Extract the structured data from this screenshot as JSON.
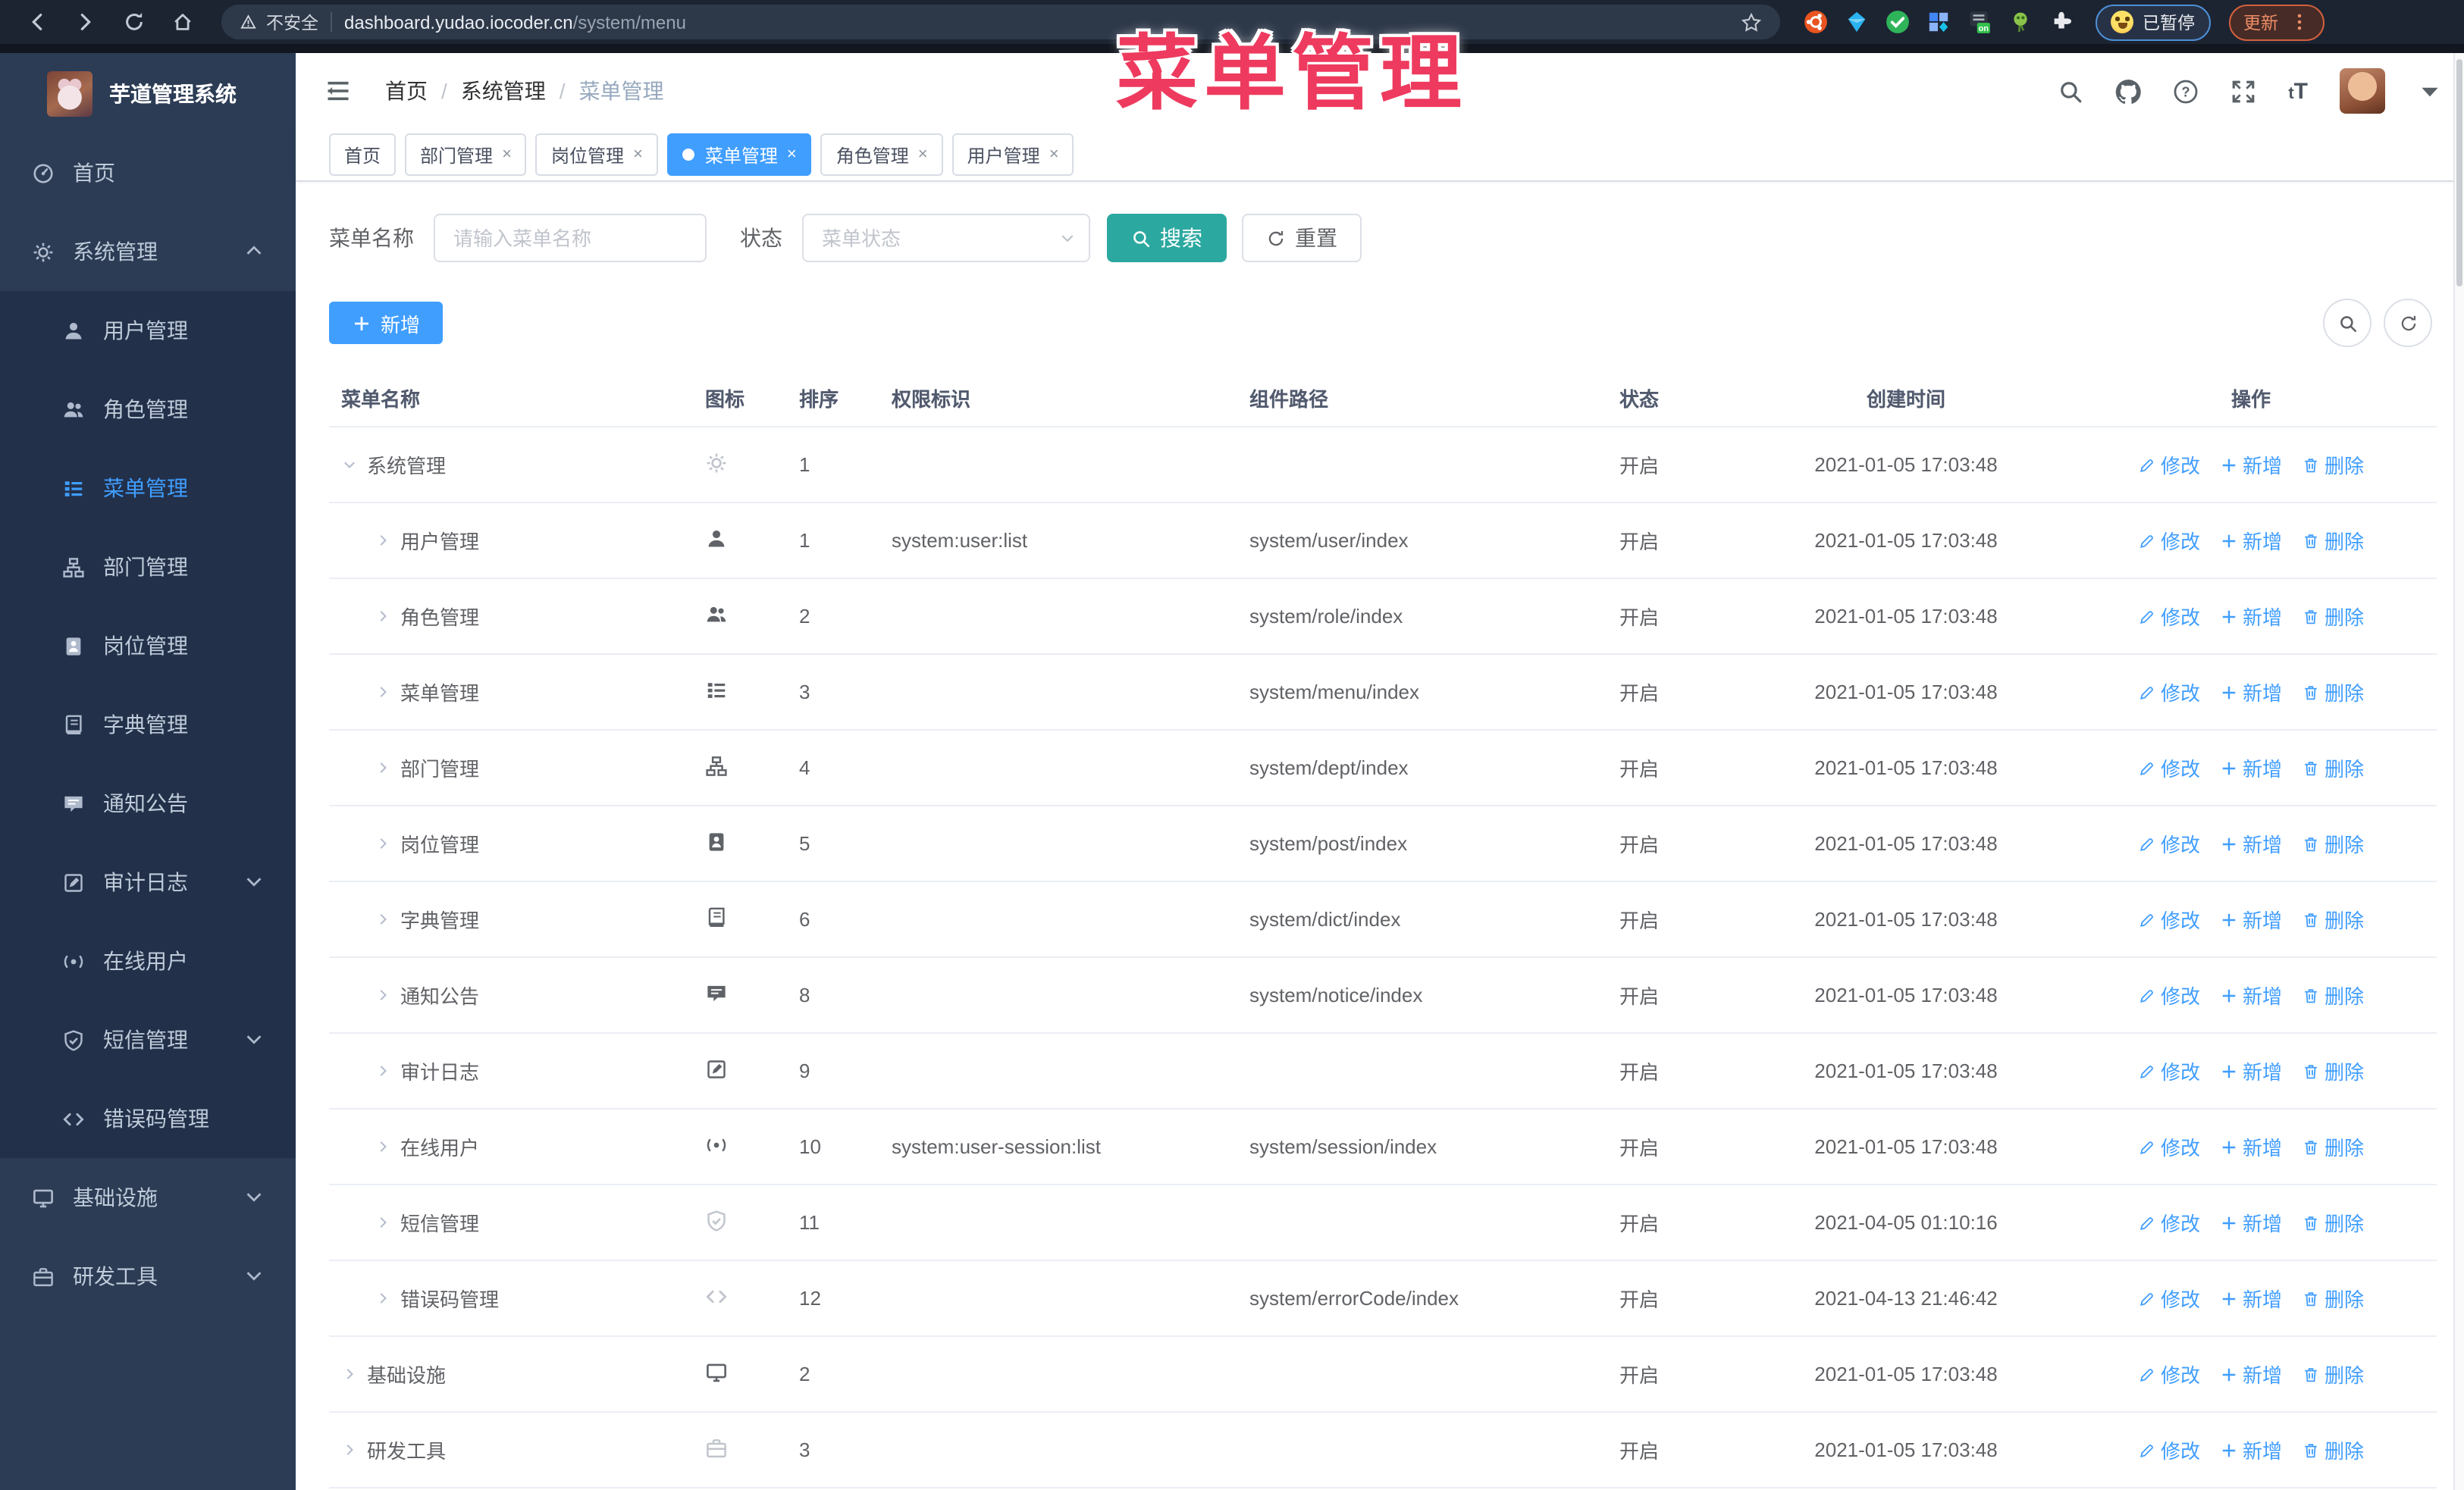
{
  "browser": {
    "security_label": "不安全",
    "url_domain": "dashboard.yudao.iocoder.cn",
    "url_path": "/system/menu",
    "extension_badge": "on",
    "profile_chip_label": "已暂停",
    "update_button_label": "更新"
  },
  "overlay": {
    "title": "菜单管理",
    "color": "#ee3a5e"
  },
  "sidebar": {
    "app_title": "芋道管理系统",
    "items": [
      {
        "label": "首页",
        "icon": "dashboard-icon"
      },
      {
        "label": "系统管理",
        "icon": "gear-icon",
        "arrow": "up",
        "children": [
          {
            "label": "用户管理",
            "icon": "user-icon"
          },
          {
            "label": "角色管理",
            "icon": "users-icon"
          },
          {
            "label": "菜单管理",
            "icon": "menu-icon",
            "active": true
          },
          {
            "label": "部门管理",
            "icon": "dept-icon"
          },
          {
            "label": "岗位管理",
            "icon": "post-icon"
          },
          {
            "label": "字典管理",
            "icon": "dict-icon"
          },
          {
            "label": "通知公告",
            "icon": "notice-icon"
          },
          {
            "label": "审计日志",
            "icon": "log-icon",
            "arrow": "down"
          },
          {
            "label": "在线用户",
            "icon": "online-icon"
          },
          {
            "label": "短信管理",
            "icon": "sms-icon",
            "arrow": "down"
          },
          {
            "label": "错误码管理",
            "icon": "code-icon"
          }
        ]
      },
      {
        "label": "基础设施",
        "icon": "infra-icon",
        "arrow": "down"
      },
      {
        "label": "研发工具",
        "icon": "tool-icon",
        "arrow": "down"
      }
    ]
  },
  "header": {
    "breadcrumb": [
      "首页",
      "系统管理",
      "菜单管理"
    ],
    "right_icons": [
      "search-icon",
      "github-icon",
      "question-icon",
      "fullscreen-icon",
      "font-size-icon",
      "avatar",
      "caret-down-icon"
    ]
  },
  "tabs": [
    {
      "label": "首页",
      "closable": false,
      "active": false
    },
    {
      "label": "部门管理",
      "closable": true,
      "active": false
    },
    {
      "label": "岗位管理",
      "closable": true,
      "active": false
    },
    {
      "label": "菜单管理",
      "closable": true,
      "active": true
    },
    {
      "label": "角色管理",
      "closable": true,
      "active": false
    },
    {
      "label": "用户管理",
      "closable": true,
      "active": false
    }
  ],
  "filters": {
    "name_label": "菜单名称",
    "name_placeholder": "请输入菜单名称",
    "status_label": "状态",
    "status_placeholder": "菜单状态",
    "search_label": "搜索",
    "reset_label": "重置"
  },
  "toolbar": {
    "add_label": "新增"
  },
  "table": {
    "columns": [
      "菜单名称",
      "图标",
      "排序",
      "权限标识",
      "组件路径",
      "状态",
      "创建时间",
      "操作"
    ],
    "actions": [
      {
        "label": "修改",
        "icon": "edit-icon"
      },
      {
        "label": "新增",
        "icon": "plus-icon"
      },
      {
        "label": "删除",
        "icon": "trash-icon"
      }
    ],
    "rows": [
      {
        "level": 0,
        "expanded": true,
        "name": "系统管理",
        "icon": "gear-icon",
        "muted": true,
        "sort": "1",
        "perm": "",
        "path": "",
        "status": "开启",
        "time": "2021-01-05 17:03:48"
      },
      {
        "level": 1,
        "expanded": false,
        "name": "用户管理",
        "icon": "user-icon",
        "muted": false,
        "sort": "1",
        "perm": "system:user:list",
        "path": "system/user/index",
        "status": "开启",
        "time": "2021-01-05 17:03:48"
      },
      {
        "level": 1,
        "expanded": false,
        "name": "角色管理",
        "icon": "users-icon",
        "muted": false,
        "sort": "2",
        "perm": "",
        "path": "system/role/index",
        "status": "开启",
        "time": "2021-01-05 17:03:48"
      },
      {
        "level": 1,
        "expanded": false,
        "name": "菜单管理",
        "icon": "menu-icon",
        "muted": false,
        "sort": "3",
        "perm": "",
        "path": "system/menu/index",
        "status": "开启",
        "time": "2021-01-05 17:03:48"
      },
      {
        "level": 1,
        "expanded": false,
        "name": "部门管理",
        "icon": "dept-icon",
        "muted": false,
        "sort": "4",
        "perm": "",
        "path": "system/dept/index",
        "status": "开启",
        "time": "2021-01-05 17:03:48"
      },
      {
        "level": 1,
        "expanded": false,
        "name": "岗位管理",
        "icon": "post-icon",
        "muted": false,
        "sort": "5",
        "perm": "",
        "path": "system/post/index",
        "status": "开启",
        "time": "2021-01-05 17:03:48"
      },
      {
        "level": 1,
        "expanded": false,
        "name": "字典管理",
        "icon": "dict-icon",
        "muted": false,
        "sort": "6",
        "perm": "",
        "path": "system/dict/index",
        "status": "开启",
        "time": "2021-01-05 17:03:48"
      },
      {
        "level": 1,
        "expanded": false,
        "name": "通知公告",
        "icon": "notice-icon",
        "muted": false,
        "sort": "8",
        "perm": "",
        "path": "system/notice/index",
        "status": "开启",
        "time": "2021-01-05 17:03:48"
      },
      {
        "level": 1,
        "expanded": false,
        "name": "审计日志",
        "icon": "log-icon",
        "muted": false,
        "sort": "9",
        "perm": "",
        "path": "",
        "status": "开启",
        "time": "2021-01-05 17:03:48"
      },
      {
        "level": 1,
        "expanded": false,
        "name": "在线用户",
        "icon": "online-icon",
        "muted": false,
        "sort": "10",
        "perm": "system:user-session:list",
        "path": "system/session/index",
        "status": "开启",
        "time": "2021-01-05 17:03:48"
      },
      {
        "level": 1,
        "expanded": false,
        "name": "短信管理",
        "icon": "sms-icon",
        "muted": true,
        "sort": "11",
        "perm": "",
        "path": "",
        "status": "开启",
        "time": "2021-04-05 01:10:16"
      },
      {
        "level": 1,
        "expanded": false,
        "name": "错误码管理",
        "icon": "code-icon",
        "muted": true,
        "sort": "12",
        "perm": "",
        "path": "system/errorCode/index",
        "status": "开启",
        "time": "2021-04-13 21:46:42"
      },
      {
        "level": 0,
        "expanded": false,
        "name": "基础设施",
        "icon": "infra-icon",
        "muted": false,
        "sort": "2",
        "perm": "",
        "path": "",
        "status": "开启",
        "time": "2021-01-05 17:03:48"
      },
      {
        "level": 0,
        "expanded": false,
        "name": "研发工具",
        "icon": "tool-icon",
        "muted": true,
        "sort": "3",
        "perm": "",
        "path": "",
        "status": "开启",
        "time": "2021-01-05 17:03:48"
      }
    ]
  }
}
